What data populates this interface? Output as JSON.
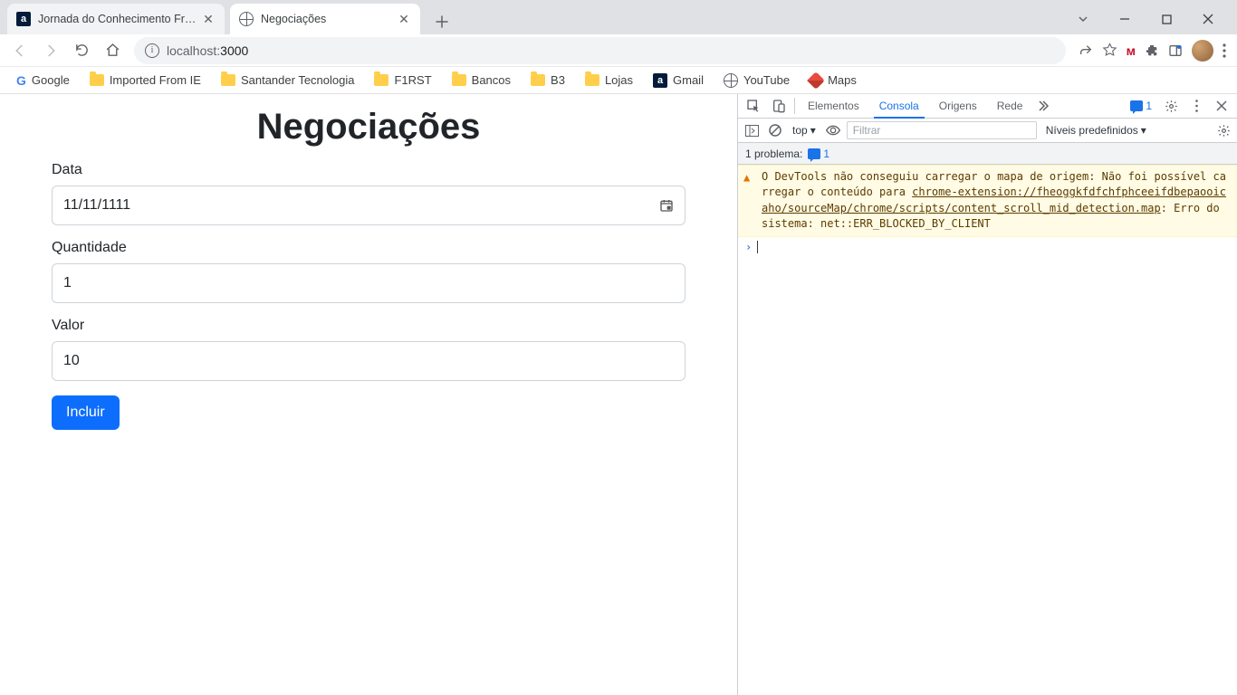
{
  "browser": {
    "tabs": [
      {
        "title": "Jornada do Conhecimento Front-",
        "favicon": "alura"
      },
      {
        "title": "Negociações",
        "favicon": "globe",
        "active": true
      }
    ],
    "url_host": "localhost:",
    "url_port": "3000",
    "bookmarks": [
      {
        "label": "Google",
        "icon": "google"
      },
      {
        "label": "Imported From IE",
        "icon": "folder"
      },
      {
        "label": "Santander Tecnologia",
        "icon": "folder"
      },
      {
        "label": "F1RST",
        "icon": "folder"
      },
      {
        "label": "Bancos",
        "icon": "folder"
      },
      {
        "label": "B3",
        "icon": "folder"
      },
      {
        "label": "Lojas",
        "icon": "folder"
      },
      {
        "label": "Gmail",
        "icon": "alura"
      },
      {
        "label": "YouTube",
        "icon": "youtube"
      },
      {
        "label": "Maps",
        "icon": "maps"
      }
    ]
  },
  "page": {
    "heading": "Negociações",
    "fields": {
      "data_label": "Data",
      "data_value": "11/11/1111",
      "qty_label": "Quantidade",
      "qty_value": "1",
      "valor_label": "Valor",
      "valor_value": "10"
    },
    "submit_label": "Incluir"
  },
  "devtools": {
    "tabs": {
      "elementos": "Elementos",
      "consola": "Consola",
      "origens": "Origens",
      "rede": "Rede"
    },
    "issues_badge": "1",
    "context": "top",
    "filter_placeholder": "Filtrar",
    "levels_label": "Níveis predefinidos",
    "problems_label": "1 problema:",
    "problems_count": "1",
    "warning": {
      "pre": "O DevTools não conseguiu carregar o mapa de origem: Não foi possível carregar o conteúdo para ",
      "link": "chrome-extension://fheoggkfdfchfphceeifdbepaooicaho/sourceMap/chrome/scripts/content_scroll_mid_detection.map",
      "post": ": Erro do sistema: net::ERR_BLOCKED_BY_CLIENT"
    }
  }
}
